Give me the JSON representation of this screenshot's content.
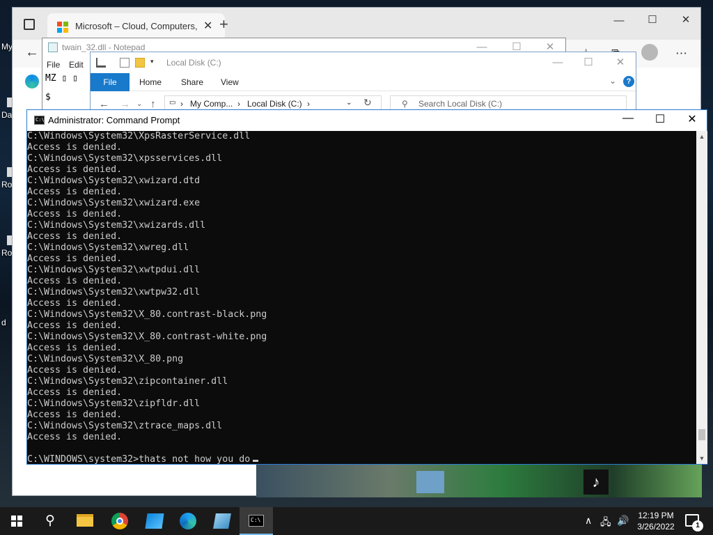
{
  "desktop": {
    "icon_labels": [
      "My",
      "Da",
      "Ro",
      "Ro",
      "d"
    ]
  },
  "edge": {
    "tab_title": "Microsoft – Cloud, Computers, Apps & Gaming",
    "tab_close": "✕",
    "new_tab": "+",
    "minimize": "—",
    "maximize": "☐",
    "close": "✕",
    "back": "←",
    "toolbar_more": "⋯"
  },
  "notepad": {
    "title": "twain_32.dll - Notepad",
    "menu_file": "File",
    "menu_edit": "Edit",
    "content_line1": "MZ ▯   ▯",
    "content_line2": "$",
    "minimize": "—",
    "maximize": "☐",
    "close": "✕"
  },
  "explorer": {
    "title": "Local Disk (C:)",
    "tab_file": "File",
    "tab_home": "Home",
    "tab_share": "Share",
    "tab_view": "View",
    "help": "?",
    "address_root": "My Comp...",
    "address_sep1": "›",
    "address_current": "Local Disk (C:)",
    "address_sep2": "›",
    "search_placeholder": "Search Local Disk (C:)",
    "minimize": "—",
    "maximize": "☐",
    "close": "✕"
  },
  "cmd": {
    "title": "Administrator: Command Prompt",
    "minimize": "—",
    "maximize": "☐",
    "close": "✕",
    "lines": [
      "C:\\Windows\\System32\\XpsRasterService.dll",
      "Access is denied.",
      "C:\\Windows\\System32\\xpsservices.dll",
      "Access is denied.",
      "C:\\Windows\\System32\\xwizard.dtd",
      "Access is denied.",
      "C:\\Windows\\System32\\xwizard.exe",
      "Access is denied.",
      "C:\\Windows\\System32\\xwizards.dll",
      "Access is denied.",
      "C:\\Windows\\System32\\xwreg.dll",
      "Access is denied.",
      "C:\\Windows\\System32\\xwtpdui.dll",
      "Access is denied.",
      "C:\\Windows\\System32\\xwtpw32.dll",
      "Access is denied.",
      "C:\\Windows\\System32\\X_80.contrast-black.png",
      "Access is denied.",
      "C:\\Windows\\System32\\X_80.contrast-white.png",
      "Access is denied.",
      "C:\\Windows\\System32\\X_80.png",
      "Access is denied.",
      "C:\\Windows\\System32\\zipcontainer.dll",
      "Access is denied.",
      "C:\\Windows\\System32\\zipfldr.dll",
      "Access is denied.",
      "C:\\Windows\\System32\\ztrace_maps.dll",
      "Access is denied.",
      "",
      "C:\\WINDOWS\\system32>thats not how you do"
    ]
  },
  "taskbar": {
    "search_glyph": "⚲",
    "time": "12:19 PM",
    "date": "3/26/2022",
    "tray_chevron": "∧",
    "tray_network": "🖧",
    "tray_volume": "🔊",
    "notification_count": "1"
  }
}
